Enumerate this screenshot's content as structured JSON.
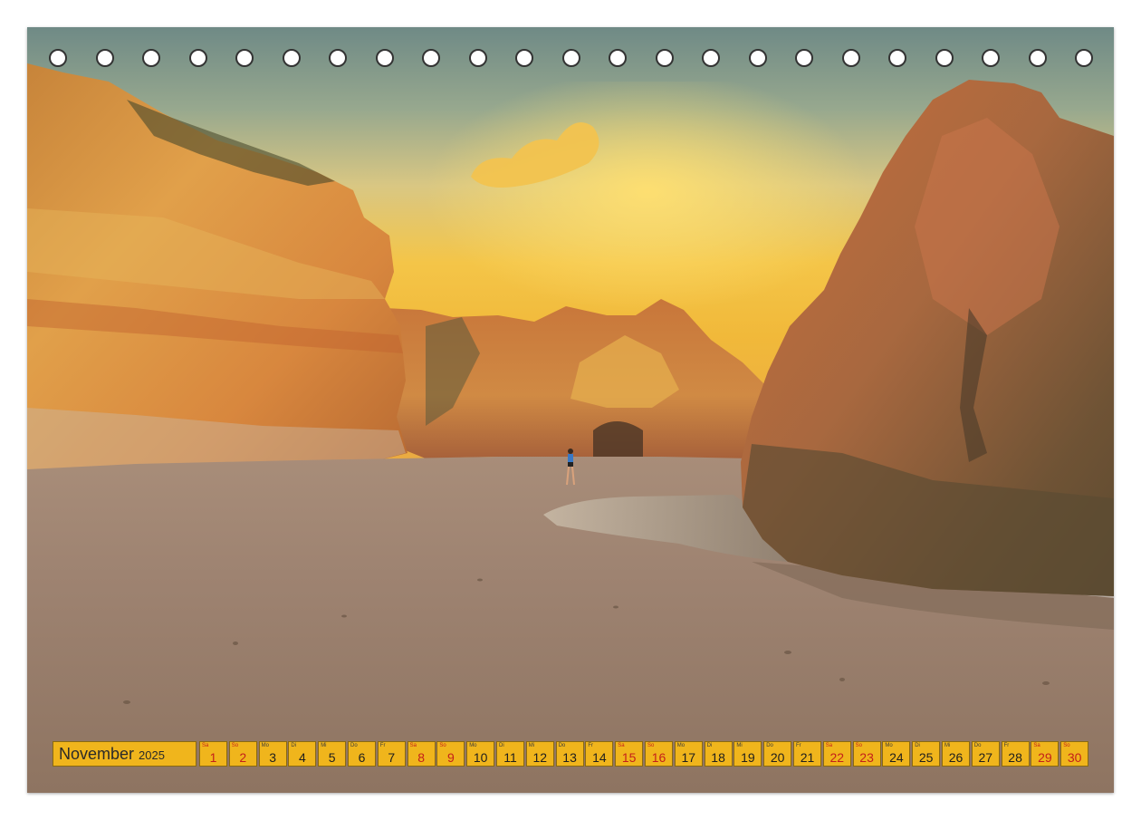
{
  "calendar": {
    "month": "November",
    "year": "2025",
    "days": [
      {
        "wd": "Sa",
        "d": "1",
        "we": true
      },
      {
        "wd": "So",
        "d": "2",
        "we": true
      },
      {
        "wd": "Mo",
        "d": "3",
        "we": false
      },
      {
        "wd": "Di",
        "d": "4",
        "we": false
      },
      {
        "wd": "Mi",
        "d": "5",
        "we": false
      },
      {
        "wd": "Do",
        "d": "6",
        "we": false
      },
      {
        "wd": "Fr",
        "d": "7",
        "we": false
      },
      {
        "wd": "Sa",
        "d": "8",
        "we": true
      },
      {
        "wd": "So",
        "d": "9",
        "we": true
      },
      {
        "wd": "Mo",
        "d": "10",
        "we": false
      },
      {
        "wd": "Di",
        "d": "11",
        "we": false
      },
      {
        "wd": "Mi",
        "d": "12",
        "we": false
      },
      {
        "wd": "Do",
        "d": "13",
        "we": false
      },
      {
        "wd": "Fr",
        "d": "14",
        "we": false
      },
      {
        "wd": "Sa",
        "d": "15",
        "we": true
      },
      {
        "wd": "So",
        "d": "16",
        "we": true
      },
      {
        "wd": "Mo",
        "d": "17",
        "we": false
      },
      {
        "wd": "Di",
        "d": "18",
        "we": false
      },
      {
        "wd": "Mi",
        "d": "19",
        "we": false
      },
      {
        "wd": "Do",
        "d": "20",
        "we": false
      },
      {
        "wd": "Fr",
        "d": "21",
        "we": false
      },
      {
        "wd": "Sa",
        "d": "22",
        "we": true
      },
      {
        "wd": "So",
        "d": "23",
        "we": true
      },
      {
        "wd": "Mo",
        "d": "24",
        "we": false
      },
      {
        "wd": "Di",
        "d": "25",
        "we": false
      },
      {
        "wd": "Mi",
        "d": "26",
        "we": false
      },
      {
        "wd": "Do",
        "d": "27",
        "we": false
      },
      {
        "wd": "Fr",
        "d": "28",
        "we": false
      },
      {
        "wd": "Sa",
        "d": "29",
        "we": true
      },
      {
        "wd": "So",
        "d": "30",
        "we": true
      }
    ]
  },
  "colors": {
    "calendar_cell": "#f0b51c",
    "weekend_text": "#c4201a",
    "weekday_text": "#1e1e1e"
  }
}
